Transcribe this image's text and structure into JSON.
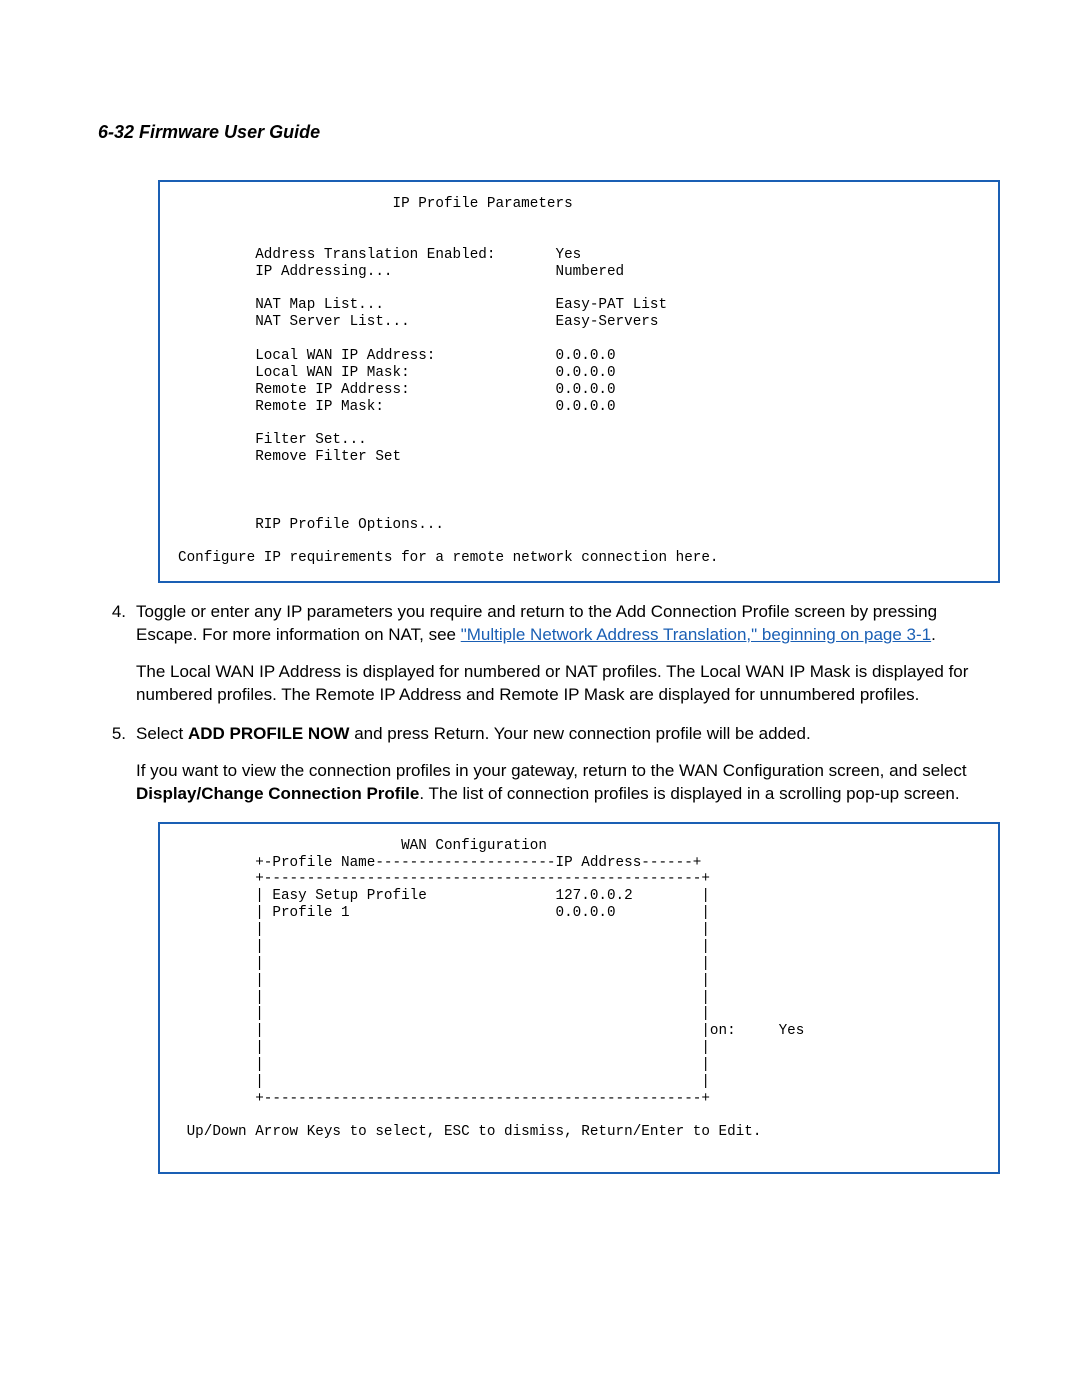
{
  "header": "6-32  Firmware User Guide",
  "terminal1": "                         IP Profile Parameters\n\n\n         Address Translation Enabled:       Yes\n         IP Addressing...                   Numbered\n\n         NAT Map List...                    Easy-PAT List\n         NAT Server List...                 Easy-Servers\n\n         Local WAN IP Address:              0.0.0.0\n         Local WAN IP Mask:                 0.0.0.0\n         Remote IP Address:                 0.0.0.0\n         Remote IP Mask:                    0.0.0.0\n\n         Filter Set...\n         Remove Filter Set\n\n\n\n         RIP Profile Options...\n\nConfigure IP requirements for a remote network connection here.",
  "step4": {
    "num": "4.",
    "p1a": "Toggle or enter any IP parameters you require and return to the Add Connection Profile screen by pressing Escape. For more information on NAT, see ",
    "link": "\"Multiple Network Address Translation,\" beginning on page 3-1",
    "p1b": ".",
    "p2": "The Local WAN IP Address is displayed for numbered or NAT profiles. The Local WAN IP Mask is displayed for numbered profiles. The Remote IP Address and Remote IP Mask are displayed for unnumbered profiles."
  },
  "step5": {
    "num": "5.",
    "p1a": "Select ",
    "bold1": "ADD PROFILE NOW",
    "p1b": " and press Return. Your new connection profile will be added.",
    "p2a": "If you want to view the connection profiles in your gateway, return to the WAN Configuration screen, and select ",
    "bold2": "Display/Change Connection Profile",
    "p2b": ". The list of connection profiles is displayed in a scrolling pop-up screen."
  },
  "terminal2": "                          WAN Configuration\n         +-Profile Name---------------------IP Address------+\n         +---------------------------------------------------+\n         | Easy Setup Profile               127.0.0.2        |\n         | Profile 1                        0.0.0.0          |\n         |                                                   |\n         |                                                   |\n         |                                                   |\n         |                                                   |\n         |                                                   |\n         |                                                   |\n         |                                                   |on:     Yes\n         |                                                   |\n         |                                                   |\n         |                                                   |\n         +---------------------------------------------------+\n\n Up/Down Arrow Keys to select, ESC to dismiss, Return/Enter to Edit.\n\n"
}
